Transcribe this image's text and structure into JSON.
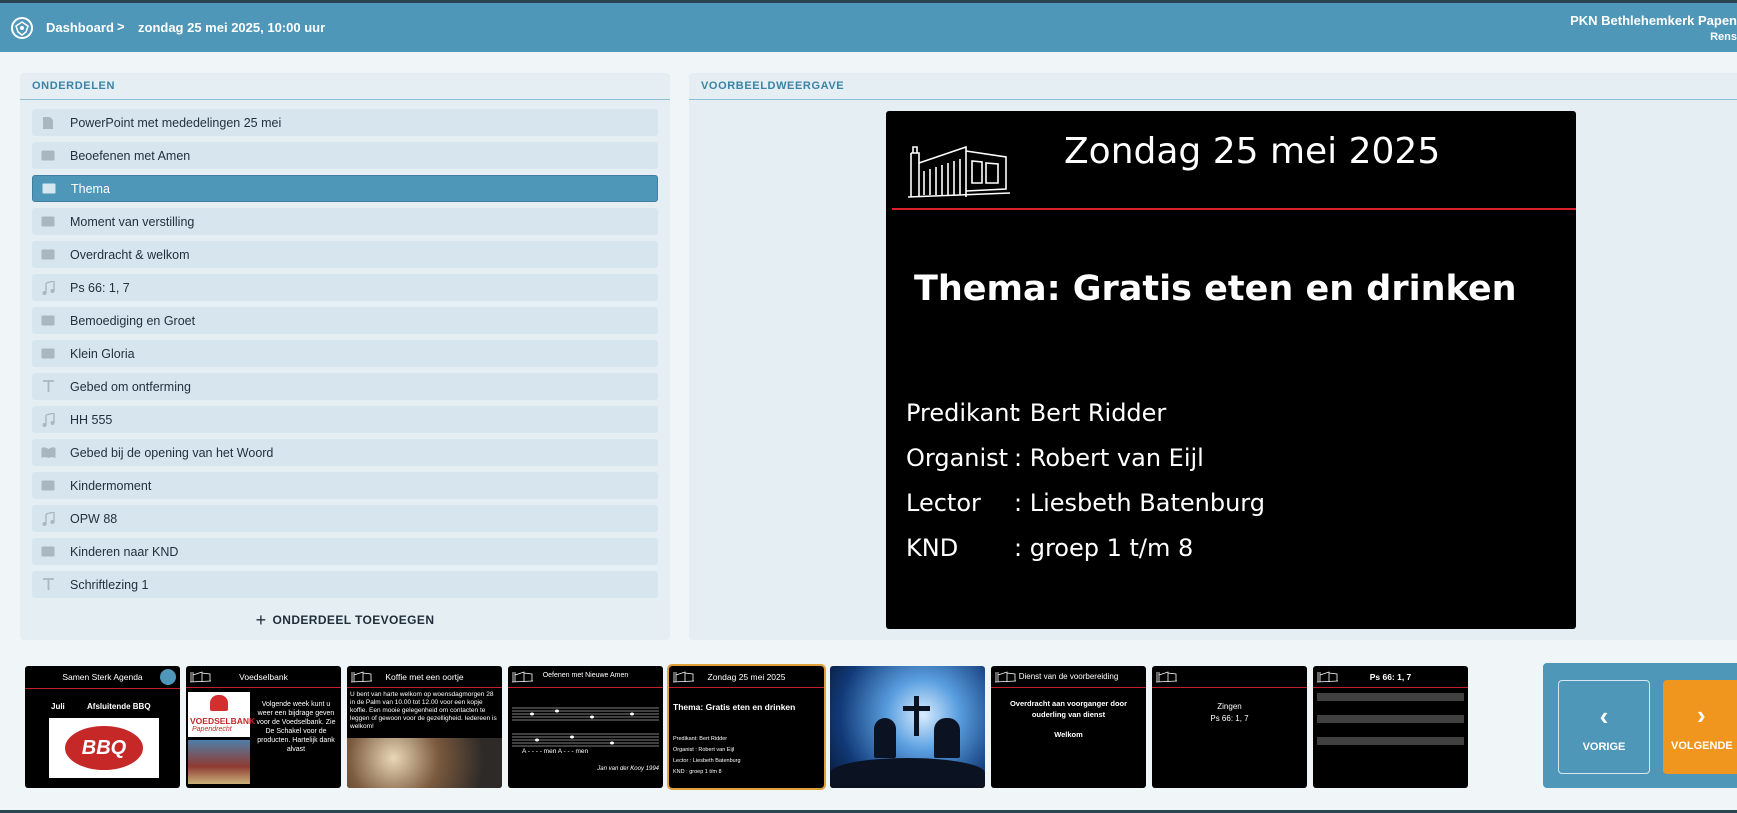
{
  "header": {
    "breadcrumb_root": "Dashboard",
    "separator": ">",
    "breadcrumb_current": "zondag 25 mei 2025, 10:00 uur",
    "organization": "PKN Bethlehemkerk Papen",
    "user": "Rens"
  },
  "parts": {
    "heading": "ONDERDELEN",
    "add_label": "ONDERDEEL TOEVOEGEN",
    "items": [
      {
        "label": "PowerPoint met mededelingen 25 mei",
        "icon": "file-icon"
      },
      {
        "label": "Beoefenen met Amen",
        "icon": "slide-icon"
      },
      {
        "label": "Thema",
        "icon": "slide-icon",
        "active": true
      },
      {
        "label": "Moment van verstilling",
        "icon": "slide-icon"
      },
      {
        "label": "Overdracht & welkom",
        "icon": "slide-icon"
      },
      {
        "label": "Ps 66: 1, 7",
        "icon": "music-icon"
      },
      {
        "label": "Bemoediging en Groet",
        "icon": "slide-icon"
      },
      {
        "label": "Klein Gloria",
        "icon": "slide-icon"
      },
      {
        "label": "Gebed om ontferming",
        "icon": "text-icon"
      },
      {
        "label": "HH 555",
        "icon": "music-icon"
      },
      {
        "label": "Gebed bij de opening van het Woord",
        "icon": "bible-icon"
      },
      {
        "label": "Kindermoment",
        "icon": "slide-icon"
      },
      {
        "label": "OPW 88",
        "icon": "music-icon"
      },
      {
        "label": "Kinderen naar KND",
        "icon": "slide-icon"
      },
      {
        "label": "Schriftlezing 1",
        "icon": "text-icon"
      }
    ]
  },
  "preview": {
    "heading": "VOORBEELDWEERGAVE",
    "date": "Zondag 25 mei 2025",
    "theme": "Thema: Gratis eten en drinken",
    "credits": [
      {
        "label": "Predikant",
        "value": ": Bert Ridder"
      },
      {
        "label": "Organist",
        "value": ": Robert van Eijl"
      },
      {
        "label": "Lector",
        "value": ": Liesbeth Batenburg"
      },
      {
        "label": "KND",
        "value": ": groep 1 t/m 8"
      }
    ]
  },
  "filmstrip": {
    "thumbs": [
      {
        "title": "Samen Sterk Agenda",
        "month": "Juli",
        "event": "Afsluitende BBQ",
        "badge": "BBQ"
      },
      {
        "title": "Voedselbank",
        "brand": "VOEDSELBANK",
        "brand_sub": "Papendrecht",
        "text": "Volgende week kunt u weer een bijdrage geven voor de Voedselbank. Zie De Schakel voor de producten. Hartelijk dank alvast"
      },
      {
        "title": "Koffie met een oortje",
        "text": "U bent van harte welkom op woensdagmorgen 28 in de Palm van 10.00 tot 12.00 voor een kopje koffie. Een mooie gelegenheid om contacten te leggen of gewoon voor de gezelligheid. Iedereen is welkom!"
      },
      {
        "title": "Oefenen met Nieuwe Amen",
        "lyric": "A - - - - men A - - - men",
        "credit": "Jan van der Kooy 1994"
      },
      {
        "title": "Zondag 25 mei 2025",
        "theme": "Thema: Gratis eten en drinken",
        "lines": [
          "Predikant: Bert Ridder",
          "Organist  : Robert van Eijl",
          "Lector      : Liesbeth Batenburg",
          "KND         : groep 1 t/m 8"
        ]
      },
      {
        "title": ""
      },
      {
        "title": "Dienst van de voorbereiding",
        "text1": "Overdracht aan voorganger door ouderling van dienst",
        "text2": "Welkom"
      },
      {
        "title": "",
        "text1": "Zingen",
        "text2": "Ps 66: 1, 7"
      },
      {
        "title": "Ps 66: 1, 7"
      }
    ]
  },
  "nav": {
    "prev_label": "VORIGE",
    "next_label": "VOLGENDE"
  },
  "colors": {
    "header": "#4f97b8",
    "panel": "#e4eef3",
    "accent_orange": "#f0961f",
    "slide_line": "#d9202a"
  }
}
